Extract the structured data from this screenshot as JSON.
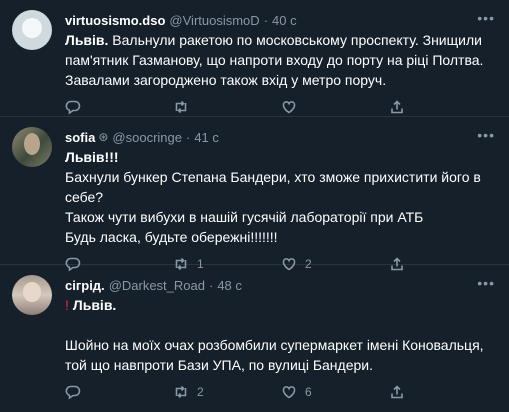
{
  "tweets": [
    {
      "name": "virtuosismo.dso",
      "verified": "",
      "handle": "@VirtuosismoD",
      "time": "40 с",
      "lead": "Львів.",
      "text": " Вальнули ракетою по московському проспекту. Знищили пам'ятник Газманову, що напроти входу до порту на ріці Полтва. Завалами загороджено також вхід у метро поруч.",
      "replies": "",
      "retweets": "",
      "likes": ""
    },
    {
      "name": "sofia",
      "verified": "⊛",
      "handle": "@soocringe",
      "time": "41 с",
      "lead": "Львів!!!",
      "text": "\nБахнули бункер Степана Бандери, хто зможе прихистити його в себе?\nТакож чути вибухи в нашій гусячій лабораторії при АТБ\nБудь ласка, будьте обережні!!!!!!!",
      "replies": "",
      "retweets": "1",
      "likes": "2"
    },
    {
      "name": "сігрід.",
      "verified": "",
      "handle": "@Darkest_Road",
      "time": "48 с",
      "warn": "!",
      "lead": "Львів.",
      "text": "\n\nШойно на моїх очах розбомбили супермаркет імені Коновальця, той що навпроти Бази УПА, по вулиці Бандери.",
      "replies": "",
      "retweets": "2",
      "likes": "6"
    }
  ],
  "icons": {
    "more": "more-horizontal-icon",
    "reply": "reply-icon",
    "retweet": "retweet-icon",
    "like": "heart-icon",
    "share": "share-icon"
  },
  "colors": {
    "background": "#15202b",
    "secondary_text": "#8899a6",
    "divider": "#2f3336",
    "warn": "#e0245e"
  }
}
